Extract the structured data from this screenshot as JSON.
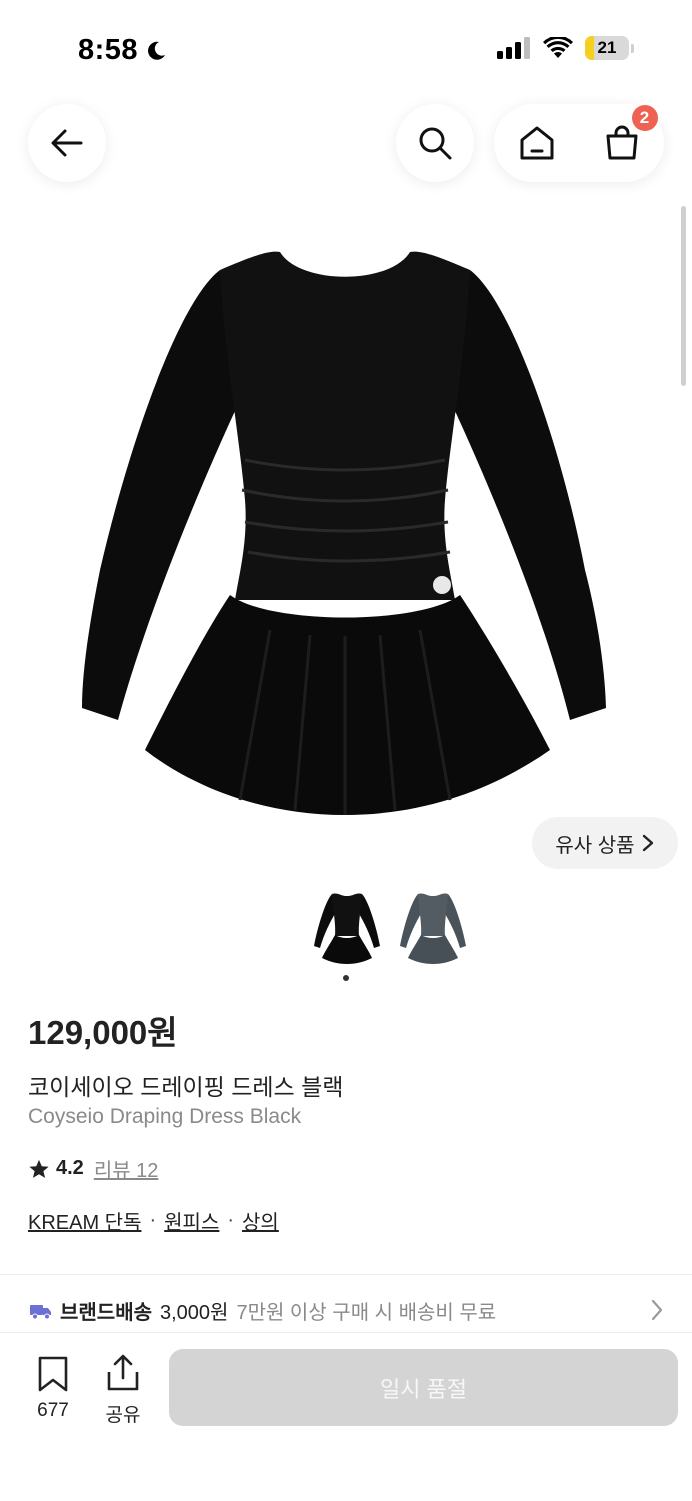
{
  "status_bar": {
    "time": "8:58",
    "battery": "21",
    "battery_level": 0.21
  },
  "header": {
    "back_icon": "arrow-left-icon",
    "search_icon": "search-icon",
    "home_icon": "home-icon",
    "cart_icon": "shopping-bag-icon",
    "cart_count": "2"
  },
  "gallery": {
    "similar_label": "유사 상품",
    "thumbnails": [
      "black",
      "gray"
    ],
    "selected_index": 0
  },
  "product": {
    "price": "129,000원",
    "name_ko": "코이세이오 드레이핑 드레스 블랙",
    "name_en": "Coyseio Draping Dress Black",
    "rating": "4.2",
    "review_label": "리뷰 12",
    "tags": [
      "KREAM 단독",
      "원피스",
      "상의"
    ]
  },
  "delivery": {
    "label": "브랜드배송",
    "fee": "3,000원",
    "note": "7만원 이상 구매 시 배송비 무료"
  },
  "bottom_bar": {
    "bookmark_count": "677",
    "share_label": "공유",
    "action_label": "일시 품절"
  },
  "colors": {
    "accent_badge": "#ef6253",
    "delivery_truck": "#6b6fd6",
    "battery_fill": "#f5d020",
    "disabled_button": "#d4d4d4"
  }
}
